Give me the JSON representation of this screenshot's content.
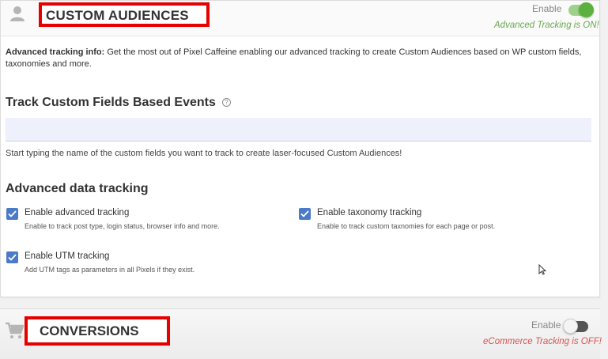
{
  "custom_audiences": {
    "title": "CUSTOM AUDIENCES",
    "enable_label": "Enable",
    "status": "Advanced Tracking is ON!",
    "info_label": "Advanced tracking info:",
    "info_text": " Get the most out of Pixel Caffeine enabling our advanced tracking to create Custom Audiences based on WP custom fields, taxonomies and more.",
    "track_fields_title": "Track Custom Fields Based Events",
    "help_glyph": "?",
    "fields_input_value": "",
    "fields_hint": "Start typing the name of the custom fields you want to track to create laser-focused Custom Audiences!",
    "advanced_title": "Advanced data tracking",
    "options": [
      {
        "label": "Enable advanced tracking",
        "desc": "Enable to track post type, login status, browser info and more.",
        "checked": true
      },
      {
        "label": "Enable taxonomy tracking",
        "desc": "Enable to track custom taxnomies for each page or post.",
        "checked": true
      },
      {
        "label": "Enable UTM tracking",
        "desc": "Add UTM tags as parameters in all Pixels if they exist.",
        "checked": true
      }
    ],
    "colors": {
      "on_status": "#6aa84f",
      "toggle_on": "#5bb13e",
      "checkbox": "#4b7bc8",
      "highlight_border": "#e60000"
    }
  },
  "conversions": {
    "title": "CONVERSIONS",
    "enable_label": "Enable",
    "status": "eCommerce Tracking is OFF!",
    "colors": {
      "off_status": "#d9534f"
    }
  },
  "icons": [
    "user-icon",
    "help-icon",
    "check-icon",
    "cart-icon",
    "mouse-cursor-icon"
  ]
}
